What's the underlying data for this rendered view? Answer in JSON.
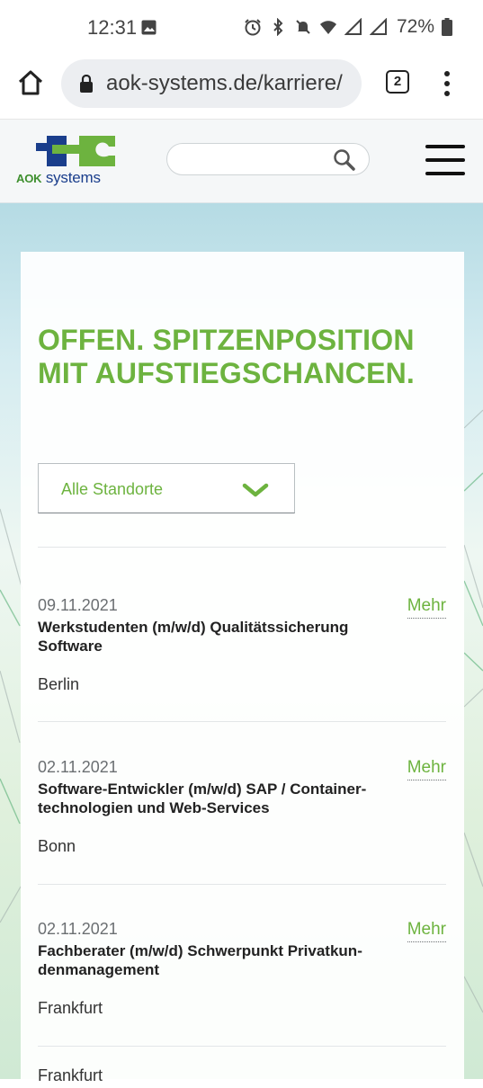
{
  "status_bar": {
    "time": "12:31",
    "battery": "72%",
    "icons": [
      "gallery-icon",
      "alarm-icon",
      "bluetooth-icon",
      "mute-icon",
      "wifi-icon",
      "signal-icon",
      "signal-r-icon",
      "battery-icon"
    ]
  },
  "browser": {
    "url": "aok-systems.de/karriere/",
    "tab_count": "2"
  },
  "site": {
    "logo_aok": "AOK",
    "logo_systems": "systems",
    "search_placeholder": ""
  },
  "main": {
    "headline": "OFFEN. SPITZENPOSITION MIT AUFSTIEGSCHANCEN.",
    "location_filter": "Alle Standorte",
    "more_label": "Mehr",
    "jobs": [
      {
        "date": "09.11.2021",
        "title": "Werkstudenten (m/w/d) Qualitätssicherung Software",
        "location": "Berlin"
      },
      {
        "date": "02.11.2021",
        "title": "Software-Entwickler (m/w/d) SAP / Container-technologien und Web-Services",
        "location": "Bonn"
      },
      {
        "date": "02.11.2021",
        "title": "Fachberater (m/w/d) Schwerpunkt Privatkun-denmanagement",
        "location": "Frankfurt"
      }
    ],
    "cutoff_text": "Frankfurt"
  },
  "colors": {
    "brand_green": "#6db33f",
    "brand_blue": "#1a3e8c"
  }
}
